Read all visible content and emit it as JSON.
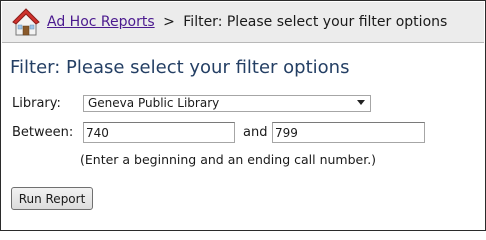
{
  "breadcrumb": {
    "parent_link": "Ad Hoc Reports",
    "separator": ">",
    "current": "Filter: Please select your filter options"
  },
  "page": {
    "title": "Filter: Please select your filter options"
  },
  "form": {
    "library_label": "Library:",
    "library_selected": "Geneva Public Library",
    "between_label": "Between:",
    "start_value": "740",
    "and_label": "and",
    "end_value": "799",
    "hint": "(Enter a beginning and an ending call number.)",
    "submit_label": "Run Report"
  },
  "colors": {
    "link": "#4b1a8f",
    "title": "#243f64",
    "topbar_bg": "#ececec"
  },
  "icons": {
    "home": "home-icon"
  }
}
